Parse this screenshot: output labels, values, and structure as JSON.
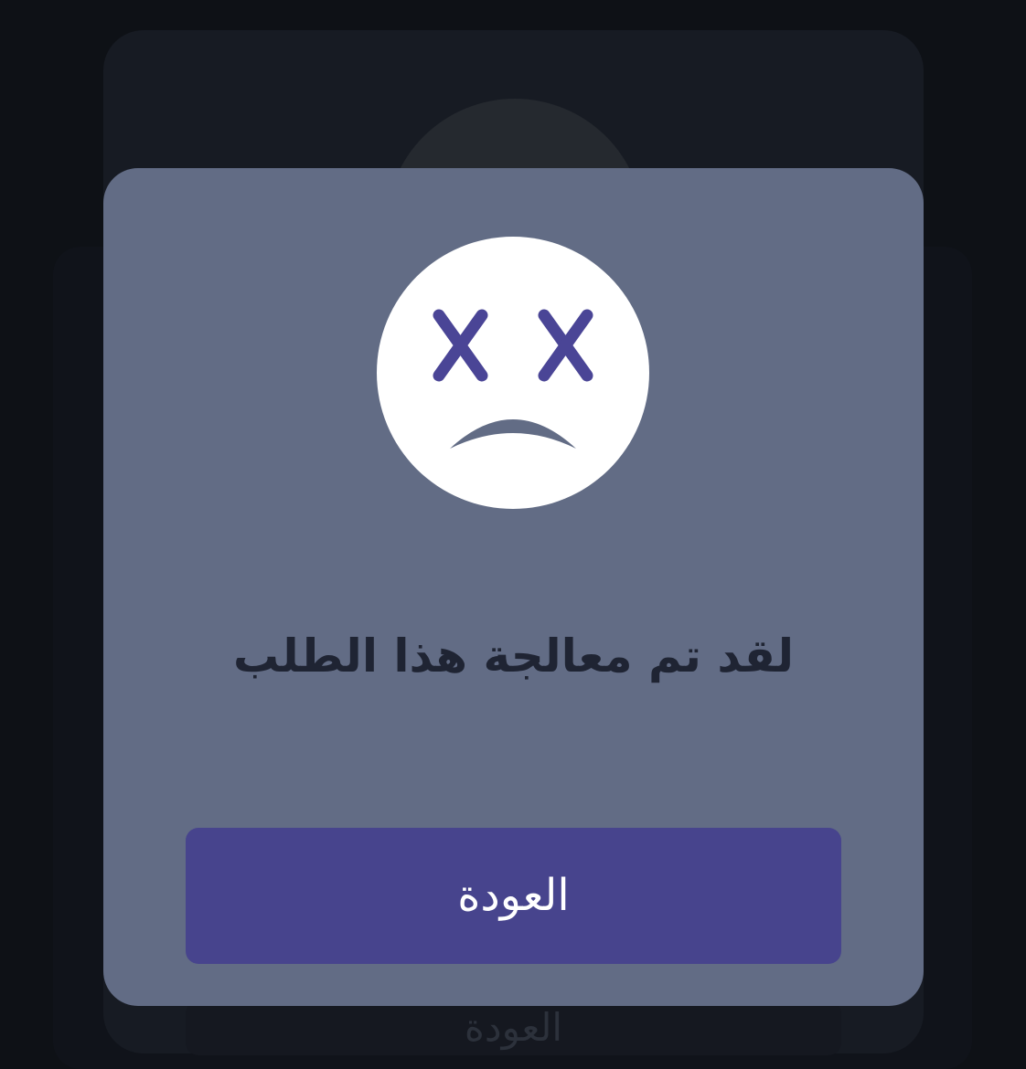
{
  "background": {
    "ghost_button_label": "العودة"
  },
  "modal": {
    "icon": "sad-face-icon",
    "title": "لقد تم معالجة هذا الطلب",
    "back_button_label": "العودة"
  },
  "colors": {
    "page_background": "#0e1116",
    "modal_background": "#626c85",
    "accent": "#47448d",
    "title_text": "#1f2433",
    "icon_background": "#ffffff"
  }
}
